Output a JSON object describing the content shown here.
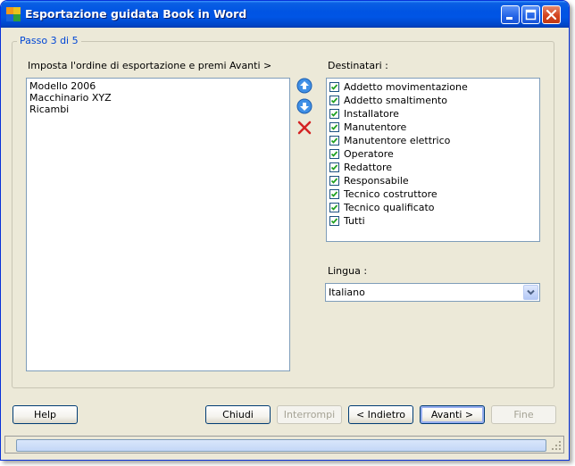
{
  "window": {
    "title": "Esportazione guidata Book in Word"
  },
  "step": {
    "label": "Passo 3 di 5"
  },
  "order_panel": {
    "label": "Imposta l'ordine di esportazione e premi Avanti >",
    "items": [
      "Modello 2006",
      "Macchinario XYZ",
      "Ricambi"
    ],
    "move_up_icon": "arrow-up-circle-icon",
    "move_down_icon": "arrow-down-circle-icon",
    "remove_icon": "red-x-icon"
  },
  "recipients": {
    "label": "Destinatari :",
    "items": [
      {
        "label": "Addetto movimentazione",
        "checked": true
      },
      {
        "label": "Addetto smaltimento",
        "checked": true
      },
      {
        "label": "Installatore",
        "checked": true
      },
      {
        "label": "Manutentore",
        "checked": true
      },
      {
        "label": "Manutentore elettrico",
        "checked": true
      },
      {
        "label": "Operatore",
        "checked": true
      },
      {
        "label": "Redattore",
        "checked": true
      },
      {
        "label": "Responsabile",
        "checked": true
      },
      {
        "label": "Tecnico costruttore",
        "checked": true
      },
      {
        "label": "Tecnico qualificato",
        "checked": true
      },
      {
        "label": "Tutti",
        "checked": true
      }
    ]
  },
  "language": {
    "label": "Lingua :",
    "selected": "Italiano"
  },
  "buttons": {
    "help": "Help",
    "close": "Chiudi",
    "interrupt": "Interrompi",
    "back": "< Indietro",
    "next": "Avanti >",
    "finish": "Fine"
  },
  "status": {
    "progress": 0
  },
  "colors": {
    "title_bar": "#0054e3",
    "group_legend": "#0046d5",
    "dialog_bg": "#ece9d8"
  }
}
